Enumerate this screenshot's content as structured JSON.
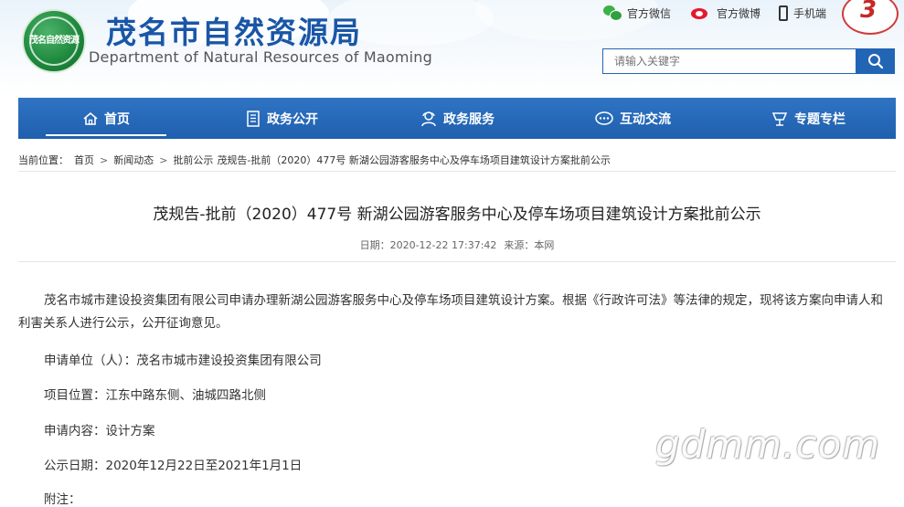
{
  "header": {
    "logo_text": "茂名自然资源",
    "site_title": "茂名市自然资源局",
    "site_subtitle": "Department of Natural Resources of Maoming",
    "badge_number": "3",
    "top_links": [
      {
        "label": "官方微信",
        "icon": "wechat-icon"
      },
      {
        "label": "官方微博",
        "icon": "weibo-icon"
      },
      {
        "label": "手机端",
        "icon": "mobile-icon"
      }
    ],
    "search": {
      "placeholder": "请输入关键字",
      "icon": "search-icon"
    }
  },
  "nav": {
    "items": [
      {
        "label": "首页",
        "icon": "home-icon",
        "active": true
      },
      {
        "label": "政务公开",
        "icon": "document-icon"
      },
      {
        "label": "政务服务",
        "icon": "service-icon"
      },
      {
        "label": "互动交流",
        "icon": "chat-icon"
      },
      {
        "label": "专题专栏",
        "icon": "topic-icon"
      }
    ]
  },
  "breadcrumb": {
    "prefix": "当前位置：",
    "items": [
      "首页",
      "新闻动态",
      "批前公示"
    ],
    "current": "茂规告-批前（2020）477号 新湖公园游客服务中心及停车场项目建筑设计方案批前公示"
  },
  "article": {
    "title": "茂规告-批前（2020）477号 新湖公园游客服务中心及停车场项目建筑设计方案批前公示",
    "date": "日期：2020-12-22 17:37:42",
    "source": "来源：本网",
    "paragraph": "茂名市城市建设投资集团有限公司申请办理新湖公园游客服务中心及停车场项目建筑设计方案。根据《行政许可法》等法律的规定，现将该方案向申请人和利害关系人进行公示，公开征询意见。",
    "applicant": "申请单位（人）：茂名市城市建设投资集团有限公司",
    "location": "项目位置：江东中路东侧、油城四路北侧",
    "content": "申请内容：设计方案",
    "period": "公示日期：2020年12月22日至2021年1月1日",
    "attachment": "附注："
  },
  "watermark": "gdmm.com",
  "colors": {
    "brand_blue": "#1f5fae",
    "title_blue": "#1a56a6",
    "logo_green": "#1f8a3e"
  }
}
